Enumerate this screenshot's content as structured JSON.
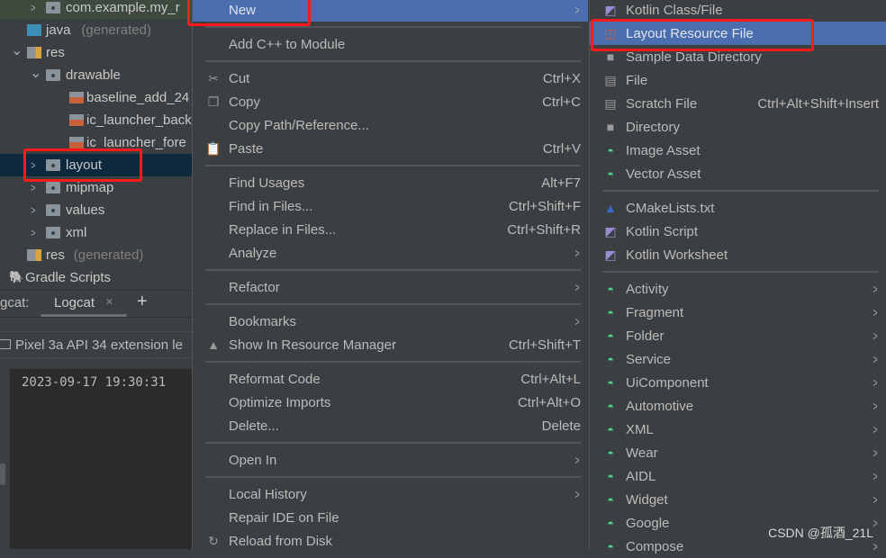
{
  "project_tree": [
    {
      "label": "com.example.my_r",
      "icon": "package-folder-icon",
      "level": 2,
      "arrow": "collapsed",
      "highlight": true
    },
    {
      "label": "java",
      "suffix": "(generated)",
      "icon": "java-generated-folder-icon",
      "level": 1
    },
    {
      "label": "res",
      "icon": "resource-folder-icon",
      "level": 0,
      "arrow": "expanded"
    },
    {
      "label": "drawable",
      "icon": "folder-icon",
      "level": 2,
      "arrow": "expanded"
    },
    {
      "label": "baseline_add_24",
      "icon": "xml-file-icon",
      "level": 3
    },
    {
      "label": "ic_launcher_back",
      "icon": "xml-file-icon",
      "level": 3
    },
    {
      "label": "ic_launcher_fore",
      "icon": "xml-file-icon",
      "level": 3
    },
    {
      "label": "layout",
      "icon": "folder-icon",
      "level": 2,
      "arrow": "collapsed",
      "selected": true
    },
    {
      "label": "mipmap",
      "icon": "folder-icon",
      "level": 2,
      "arrow": "collapsed"
    },
    {
      "label": "values",
      "icon": "folder-icon",
      "level": 2,
      "arrow": "collapsed"
    },
    {
      "label": "xml",
      "icon": "folder-icon",
      "level": 2,
      "arrow": "collapsed"
    },
    {
      "label": "res",
      "suffix": "(generated)",
      "icon": "resource-folder-icon",
      "level": 1
    },
    {
      "label": "Gradle Scripts",
      "icon": "gradle-elephant-icon",
      "level": -1
    }
  ],
  "logcat": {
    "prefix": "gcat:",
    "tab": "Logcat",
    "close": "×",
    "add": "+",
    "device": "Pixel 3a API 34 extension le",
    "log_line": "2023-09-17 19:30:31"
  },
  "context_menu": [
    {
      "label": "New",
      "submenu": true,
      "active": true
    },
    {
      "sep": true
    },
    {
      "label": "Add C++ to Module"
    },
    {
      "sep": true
    },
    {
      "label": "Cut",
      "shortcut": "Ctrl+X",
      "icon": "scissors-icon"
    },
    {
      "label": "Copy",
      "shortcut": "Ctrl+C",
      "icon": "copy-icon"
    },
    {
      "label": "Copy Path/Reference..."
    },
    {
      "label": "Paste",
      "shortcut": "Ctrl+V",
      "icon": "clipboard-icon"
    },
    {
      "sep": true
    },
    {
      "label": "Find Usages",
      "shortcut": "Alt+F7"
    },
    {
      "label": "Find in Files...",
      "shortcut": "Ctrl+Shift+F"
    },
    {
      "label": "Replace in Files...",
      "shortcut": "Ctrl+Shift+R"
    },
    {
      "label": "Analyze",
      "submenu": true
    },
    {
      "sep": true
    },
    {
      "label": "Refactor",
      "submenu": true
    },
    {
      "sep": true
    },
    {
      "label": "Bookmarks",
      "submenu": true
    },
    {
      "label": "Show In Resource Manager",
      "shortcut": "Ctrl+Shift+T",
      "icon": "resource-manager-icon"
    },
    {
      "sep": true
    },
    {
      "label": "Reformat Code",
      "shortcut": "Ctrl+Alt+L"
    },
    {
      "label": "Optimize Imports",
      "shortcut": "Ctrl+Alt+O"
    },
    {
      "label": "Delete...",
      "shortcut": "Delete"
    },
    {
      "sep": true
    },
    {
      "label": "Open In",
      "submenu": true
    },
    {
      "sep": true
    },
    {
      "label": "Local History",
      "submenu": true
    },
    {
      "label": "Repair IDE on File"
    },
    {
      "label": "Reload from Disk",
      "icon": "reload-icon"
    }
  ],
  "new_submenu": [
    {
      "label": "Kotlin Class/File",
      "icon": "kotlin-file-icon"
    },
    {
      "label": "Layout Resource File",
      "icon": "layout-xml-icon",
      "active": true
    },
    {
      "label": "Sample Data Directory",
      "icon": "folder-icon"
    },
    {
      "label": "File",
      "icon": "file-icon"
    },
    {
      "label": "Scratch File",
      "shortcut": "Ctrl+Alt+Shift+Insert",
      "icon": "scratch-file-icon"
    },
    {
      "label": "Directory",
      "icon": "folder-icon"
    },
    {
      "label": "Image Asset",
      "icon": "android-icon"
    },
    {
      "label": "Vector Asset",
      "icon": "android-icon"
    },
    {
      "sep": true
    },
    {
      "label": "CMakeLists.txt",
      "icon": "cmake-icon"
    },
    {
      "label": "Kotlin Script",
      "icon": "kotlin-script-icon"
    },
    {
      "label": "Kotlin Worksheet",
      "icon": "kotlin-script-icon"
    },
    {
      "sep": true
    },
    {
      "label": "Activity",
      "icon": "android-icon",
      "submenu": true
    },
    {
      "label": "Fragment",
      "icon": "android-icon",
      "submenu": true
    },
    {
      "label": "Folder",
      "icon": "android-icon",
      "submenu": true
    },
    {
      "label": "Service",
      "icon": "android-icon",
      "submenu": true
    },
    {
      "label": "UiComponent",
      "icon": "android-icon",
      "submenu": true
    },
    {
      "label": "Automotive",
      "icon": "android-icon",
      "submenu": true
    },
    {
      "label": "XML",
      "icon": "android-icon",
      "submenu": true
    },
    {
      "label": "Wear",
      "icon": "android-icon",
      "submenu": true
    },
    {
      "label": "AIDL",
      "icon": "android-icon",
      "submenu": true
    },
    {
      "label": "Widget",
      "icon": "android-icon",
      "submenu": true
    },
    {
      "label": "Google",
      "icon": "android-icon",
      "submenu": true
    },
    {
      "label": "Compose",
      "icon": "android-icon",
      "submenu": true
    }
  ],
  "watermark": "CSDN @孤酒_21L",
  "colors": {
    "menu_bg": "#3c3f41",
    "highlight": "#4b6eaf",
    "selection": "#0d293e",
    "annotation": "#ff1a1a",
    "android_green": "#3ddc84"
  }
}
